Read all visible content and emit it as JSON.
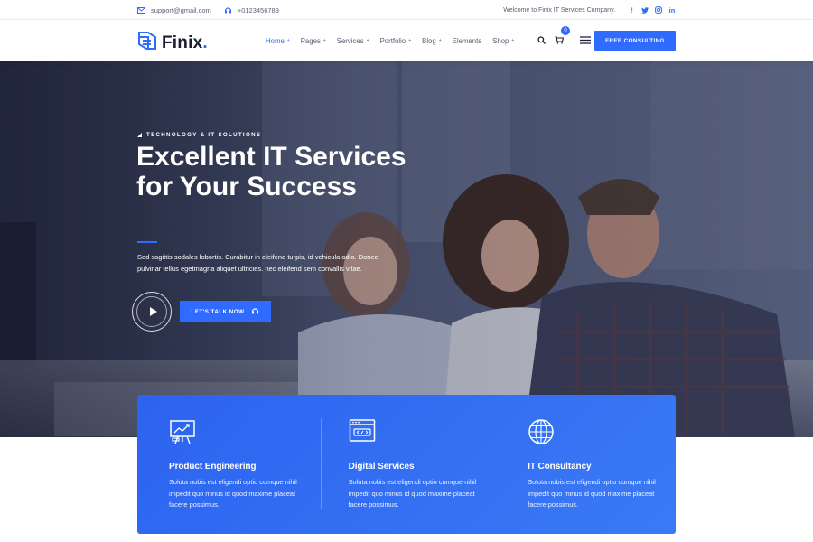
{
  "topbar": {
    "email": "support@gmail.com",
    "phone": "+0123456789",
    "welcome": "Welcome to Finix IT Services Company.",
    "social": [
      "f",
      "t",
      "ig",
      "in"
    ]
  },
  "header": {
    "logo": "Finix",
    "logo_dot": ".",
    "nav": [
      {
        "label": "Home",
        "has_caret": true,
        "active": true
      },
      {
        "label": "Pages",
        "has_caret": true
      },
      {
        "label": "Services",
        "has_caret": true
      },
      {
        "label": "Portfolio",
        "has_caret": true
      },
      {
        "label": "Blog",
        "has_caret": true
      },
      {
        "label": "Elements",
        "has_caret": false
      },
      {
        "label": "Shop",
        "has_caret": true
      }
    ],
    "cart_count": "0",
    "cta": "FREE CONSULTING",
    "icons": [
      "search-icon",
      "cart-icon",
      "hamburger-menu-icon"
    ]
  },
  "hero": {
    "eyebrow": "TECHNOLOGY & IT SOLUTIONS",
    "headline": "Excellent IT Services for Your Success",
    "lead": "Sed sagittis sodales lobortis. Curabitur in eleifend turpis, id vehicula odio. Donec pulvinar tellus egetmagna aliquet ultricies. nec eleifend sem convallis vitae.",
    "cta": "LET'S TALK NOW"
  },
  "services": [
    {
      "icon": "presentation-board-icon",
      "title": "Product Engineering",
      "desc": "Soluta nobis est eligendi optio cumque nihil impedit quo minus id quod maxime placeat facere possimus."
    },
    {
      "icon": "browser-window-icon",
      "title": "Digital Services",
      "desc": "Soluta nobis est eligendi optio cumque nihil impedit quo minus id quod maxime placeat facere possimus."
    },
    {
      "icon": "globe-icon",
      "title": "IT Consultancy",
      "desc": "Soluta nobis est eligendi optio cumque nihil impedit quo minus id quod maxime placeat facere possimus."
    }
  ],
  "colors": {
    "accent": "#2f6bff",
    "dark": "#1b1d36",
    "muted": "#5b5e74",
    "services_bg": "#2c63f0"
  }
}
